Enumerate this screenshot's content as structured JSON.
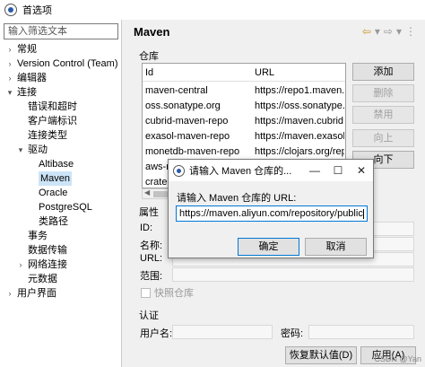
{
  "window": {
    "title": "首选项"
  },
  "filter": {
    "placeholder": "输入筛选文本"
  },
  "tree": [
    {
      "label": "常规",
      "level": 0,
      "toggle": ">"
    },
    {
      "label": "Version Control (Team)",
      "level": 0,
      "toggle": ">"
    },
    {
      "label": "编辑器",
      "level": 0,
      "toggle": ">"
    },
    {
      "label": "连接",
      "level": 0,
      "toggle": "v"
    },
    {
      "label": "错误和超时",
      "level": 1,
      "toggle": ""
    },
    {
      "label": "客户端标识",
      "level": 1,
      "toggle": ""
    },
    {
      "label": "连接类型",
      "level": 1,
      "toggle": ""
    },
    {
      "label": "驱动",
      "level": 1,
      "toggle": "v"
    },
    {
      "label": "Altibase",
      "level": 2,
      "toggle": ""
    },
    {
      "label": "Maven",
      "level": 2,
      "toggle": "",
      "selected": true
    },
    {
      "label": "Oracle",
      "level": 2,
      "toggle": ""
    },
    {
      "label": "PostgreSQL",
      "level": 2,
      "toggle": ""
    },
    {
      "label": "类路径",
      "level": 2,
      "toggle": ""
    },
    {
      "label": "事务",
      "level": 1,
      "toggle": ""
    },
    {
      "label": "数据传输",
      "level": 1,
      "toggle": ""
    },
    {
      "label": "网络连接",
      "level": 1,
      "toggle": ">"
    },
    {
      "label": "元数据",
      "level": 1,
      "toggle": ""
    },
    {
      "label": "用户界面",
      "level": 0,
      "toggle": ">"
    }
  ],
  "page": {
    "title": "Maven"
  },
  "repos": {
    "group_label": "仓库",
    "columns": [
      "Id",
      "URL"
    ],
    "rows": [
      [
        "maven-central",
        "https://repo1.maven.or"
      ],
      [
        "oss.sonatype.org",
        "https://oss.sonatype.or"
      ],
      [
        "cubrid-maven-repo",
        "https://maven.cubrid.or"
      ],
      [
        "exasol-maven-repo",
        "https://maven.exasol.cc"
      ],
      [
        "monetdb-maven-repo",
        "https://clojars.org/rep"
      ],
      [
        "aws-redshift-maven-repo",
        "https://s3.amazonaws.c"
      ],
      [
        "cratedb",
        ""
      ]
    ]
  },
  "buttons": {
    "add": "添加",
    "delete": "删除",
    "disable": "禁用",
    "up": "向上",
    "down": "向下",
    "restore": "恢复默认值(D)",
    "apply": "应用(A)"
  },
  "props": {
    "group_label": "属性",
    "id": "ID:",
    "name": "名称:",
    "url": "URL:",
    "scope": "范围:",
    "fast_repo": "快照仓库"
  },
  "auth": {
    "group_label": "认证",
    "user": "用户名:",
    "password": "密码:"
  },
  "dialog": {
    "title": "请输入 Maven 仓库的...",
    "prompt": "请输入 Maven 仓库的 URL:",
    "value": "https://maven.aliyun.com/repository/public",
    "ok": "确定",
    "cancel": "取消",
    "minimize": "—",
    "maximize": "☐",
    "close": "✕"
  },
  "watermark": "CSDN @Yan"
}
